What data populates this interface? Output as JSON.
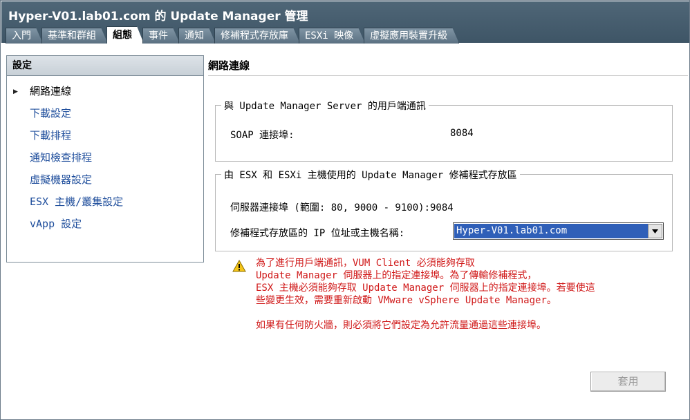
{
  "window": {
    "title": "Hyper-V01.lab01.com 的 Update Manager 管理"
  },
  "tabs": [
    {
      "label": "入門"
    },
    {
      "label": "基準和群組"
    },
    {
      "label": "組態"
    },
    {
      "label": "事件"
    },
    {
      "label": "通知"
    },
    {
      "label": "修補程式存放庫"
    },
    {
      "label": "ESXi 映像"
    },
    {
      "label": "虛擬應用裝置升級"
    }
  ],
  "active_tab": "組態",
  "sidebar": {
    "header": "設定",
    "items": [
      {
        "label": "網路連線"
      },
      {
        "label": "下載設定"
      },
      {
        "label": "下載排程"
      },
      {
        "label": "通知檢查排程"
      },
      {
        "label": "虛擬機器設定"
      },
      {
        "label": "ESX 主機/叢集設定"
      },
      {
        "label": "vApp 設定"
      }
    ]
  },
  "main": {
    "heading": "網路連線",
    "group1": {
      "legend": "與 Update Manager Server 的用戶端通訊",
      "soap_label": "SOAP 連接埠:",
      "soap_value": "8084"
    },
    "group2": {
      "legend": "由 ESX 和 ESXi 主機使用的 Update Manager 修補程式存放區",
      "server_port_text": "伺服器連接埠 (範圍: 80, 9000 - 9100):9084",
      "ip_label": "修補程式存放區的 IP 位址或主機名稱:",
      "ip_value": "Hyper-V01.lab01.com"
    },
    "warning_lines": [
      "為了進行用戶端通訊，VUM Client 必須能夠存取",
      "Update Manager 伺服器上的指定連接埠。為了傳輸修補程式，",
      "ESX 主機必須能夠存取 Update Manager 伺服器上的指定連接埠。若要使這",
      "些變更生效，需要重新啟動 VMware vSphere Update Manager。"
    ],
    "firewall_note": "如果有任何防火牆，則必須將它們設定為允許流量通過這些連接埠。",
    "apply_label": "套用"
  },
  "colors": {
    "titlebar": "#3e5566",
    "link": "#1f4e9c",
    "warning": "#d01919",
    "selection": "#2f5fb8"
  }
}
